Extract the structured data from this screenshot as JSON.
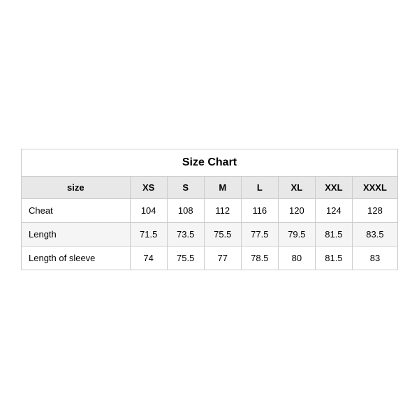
{
  "table": {
    "title": "Size Chart",
    "headers": [
      "size",
      "XS",
      "S",
      "M",
      "L",
      "XL",
      "XXL",
      "XXXL"
    ],
    "rows": [
      {
        "label": "Cheat",
        "values": [
          "104",
          "108",
          "112",
          "116",
          "120",
          "124",
          "128"
        ]
      },
      {
        "label": "Length",
        "values": [
          "71.5",
          "73.5",
          "75.5",
          "77.5",
          "79.5",
          "81.5",
          "83.5"
        ]
      },
      {
        "label": "Length of sleeve",
        "values": [
          "74",
          "75.5",
          "77",
          "78.5",
          "80",
          "81.5",
          "83"
        ]
      }
    ]
  }
}
